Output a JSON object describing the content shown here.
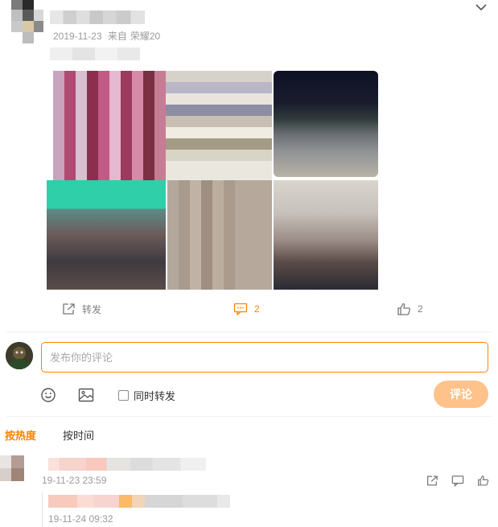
{
  "post": {
    "date": "2019-11-23",
    "source_prefix": "来自",
    "source_device": "荣耀20"
  },
  "actions": {
    "forward_label": "转发",
    "comment_count": "2",
    "like_count": "2"
  },
  "composer": {
    "placeholder": "发布你的评论",
    "repost_label": "同时转发",
    "submit_label": "评论"
  },
  "sort_tabs": {
    "hot": "按热度",
    "time": "按时间"
  },
  "comments": [
    {
      "time": "19-11-23 23:59",
      "reply_time": "19-11-24 09:32"
    }
  ],
  "colors": {
    "accent": "#ff8200",
    "submit_disabled": "#ffc28a",
    "muted_text": "#9b9b9b"
  },
  "icons": {
    "header_menu": "chevron-down-icon",
    "forward": "share-icon",
    "comment": "comment-icon",
    "like": "thumbs-up-icon",
    "emoji": "emoji-icon",
    "image": "image-icon"
  }
}
